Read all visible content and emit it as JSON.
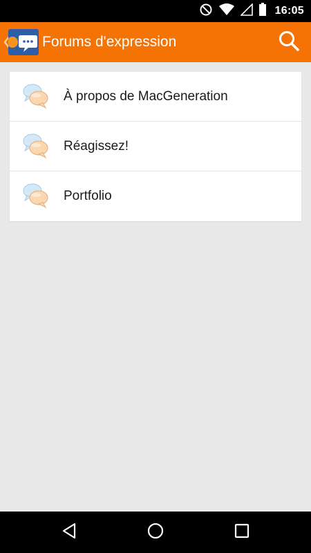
{
  "status_bar": {
    "time": "16:05",
    "icons": [
      "do-not-disturb-icon",
      "wifi-icon",
      "cell-signal-icon",
      "battery-icon"
    ]
  },
  "app_bar": {
    "title": "Forums d'expression",
    "background_color": "#f57304",
    "icons": [
      "back-chevron-icon",
      "app-logo-icon",
      "search-icon"
    ]
  },
  "forums": {
    "items": [
      {
        "label": "À propos de MacGeneration",
        "icon": "chat-bubbles-icon"
      },
      {
        "label": "Réagissez!",
        "icon": "chat-bubbles-icon"
      },
      {
        "label": "Portfolio",
        "icon": "chat-bubbles-icon"
      }
    ]
  },
  "nav_bar": {
    "icons": [
      "back-icon",
      "home-icon",
      "recents-icon"
    ]
  }
}
